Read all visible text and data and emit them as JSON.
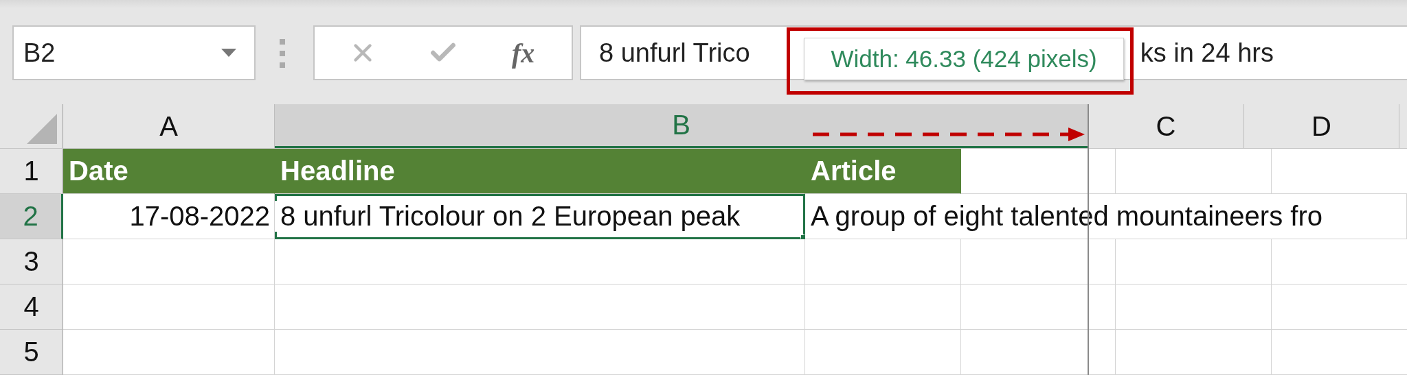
{
  "name_box": {
    "value": "B2"
  },
  "formula_bar": {
    "buttons": [
      {
        "kind": "cancel"
      },
      {
        "kind": "enter"
      },
      {
        "kind": "function",
        "label": "fx"
      }
    ],
    "value_start": "8 unfurl Trico",
    "value_end": "ks in 24 hrs"
  },
  "tooltip": {
    "text": "Width: 46.33 (424 pixels)"
  },
  "columns": [
    {
      "label": "A",
      "selected": false
    },
    {
      "label": "B",
      "selected": true
    },
    {
      "label": "C",
      "selected": false
    },
    {
      "label": "D",
      "selected": false
    }
  ],
  "rows": [
    {
      "label": "1",
      "selected": false,
      "cells": [
        {
          "kind": "header",
          "text": "Date",
          "selected": false
        },
        {
          "kind": "header",
          "text": "Headline",
          "selected": false
        },
        {
          "kind": "header",
          "text": "Article",
          "selected": false
        }
      ]
    },
    {
      "label": "2",
      "selected": true,
      "cells": [
        {
          "kind": "date",
          "text": "17-08-2022",
          "selected": false
        },
        {
          "kind": "text",
          "text": "8 unfurl Tricolour on 2 European peak",
          "selected": true
        },
        {
          "kind": "text",
          "text": "A group of eight talented mountaineers fro",
          "selected": false
        }
      ]
    },
    {
      "label": "3",
      "selected": false
    },
    {
      "label": "4",
      "selected": false
    },
    {
      "label": "5",
      "selected": false
    }
  ]
}
